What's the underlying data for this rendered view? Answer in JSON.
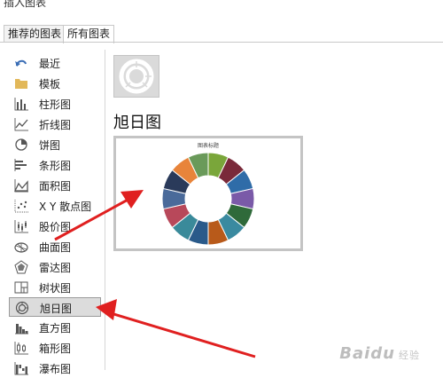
{
  "dialog": {
    "title": "插入图表"
  },
  "tabs": [
    {
      "label": "推荐的图表"
    },
    {
      "label": "所有图表"
    }
  ],
  "sidebar": {
    "items": [
      {
        "label": "最近",
        "icon": "recent-icon"
      },
      {
        "label": "模板",
        "icon": "folder-icon"
      },
      {
        "label": "柱形图",
        "icon": "column-chart-icon"
      },
      {
        "label": "折线图",
        "icon": "line-chart-icon"
      },
      {
        "label": "饼图",
        "icon": "pie-chart-icon"
      },
      {
        "label": "条形图",
        "icon": "bar-chart-icon"
      },
      {
        "label": "面积图",
        "icon": "area-chart-icon"
      },
      {
        "label": "X Y 散点图",
        "icon": "scatter-chart-icon"
      },
      {
        "label": "股价图",
        "icon": "stock-chart-icon"
      },
      {
        "label": "曲面图",
        "icon": "surface-chart-icon"
      },
      {
        "label": "雷达图",
        "icon": "radar-chart-icon"
      },
      {
        "label": "树状图",
        "icon": "treemap-chart-icon"
      },
      {
        "label": "旭日图",
        "icon": "sunburst-chart-icon"
      },
      {
        "label": "直方图",
        "icon": "histogram-chart-icon"
      },
      {
        "label": "箱形图",
        "icon": "box-chart-icon"
      },
      {
        "label": "瀑布图",
        "icon": "waterfall-chart-icon"
      }
    ],
    "selected": "旭日图"
  },
  "main": {
    "chart_type_title": "旭日图",
    "preview_title": "图表标题"
  },
  "watermark": {
    "text": "Baidu",
    "suffix": "经验"
  },
  "colors": {
    "arrow": "#e02020",
    "selected_bg": "#dcdcdc",
    "sunburst": [
      "#7aa63a",
      "#7a2a3a",
      "#2f6ca8",
      "#7a5aa8",
      "#2f6a3a",
      "#3a8aa0",
      "#b85a1a",
      "#2a5a8a",
      "#3a8a9a",
      "#b8485a",
      "#4a6a9a",
      "#2a3a5a",
      "#e8843a",
      "#6a9a5a"
    ]
  }
}
